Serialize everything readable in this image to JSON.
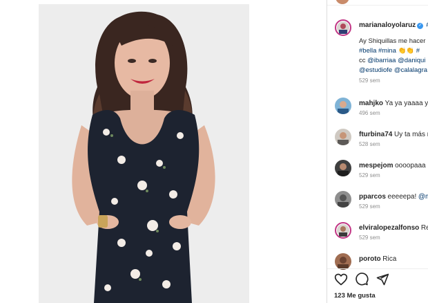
{
  "post": {
    "author": "marianaloyolaruz",
    "caption_line1": "Ay Shiquillas me hacer",
    "caption_line2": "#bella #mina 👏👏 #",
    "caption_line3_prefix": "cc",
    "caption_mention1": "@ibarriaa",
    "caption_mention2": "@daniqui",
    "caption_mention3": "@estudiofe",
    "caption_mention4": "@calalagra",
    "time": "529 sem",
    "likes": "123 Me gusta"
  },
  "comments": [
    {
      "user": "mahjko",
      "text": "Ya ya yaaaa ya",
      "time": "496 sem"
    },
    {
      "user": "fturbina74",
      "text": "Uy ta más r",
      "time": "528 sem"
    },
    {
      "user": "mespejom",
      "text": "oooopaaa l",
      "time": "529 sem"
    },
    {
      "user": "pparcos",
      "text": "eeeeepa!",
      "mention": "@m",
      "time": "529 sem"
    },
    {
      "user": "elviralopezalfonso",
      "text": "Reg",
      "time": "529 sem"
    },
    {
      "user": "poroto",
      "text": "Rica",
      "time": ""
    }
  ],
  "icons": {
    "like": "heart-icon",
    "comment": "comment-icon",
    "share": "share-icon",
    "verified": "verified-badge-icon"
  },
  "colors": {
    "link": "#00376b",
    "verified": "#3897f0",
    "story_ring": "#c13584",
    "meta": "#8e8e8e"
  }
}
